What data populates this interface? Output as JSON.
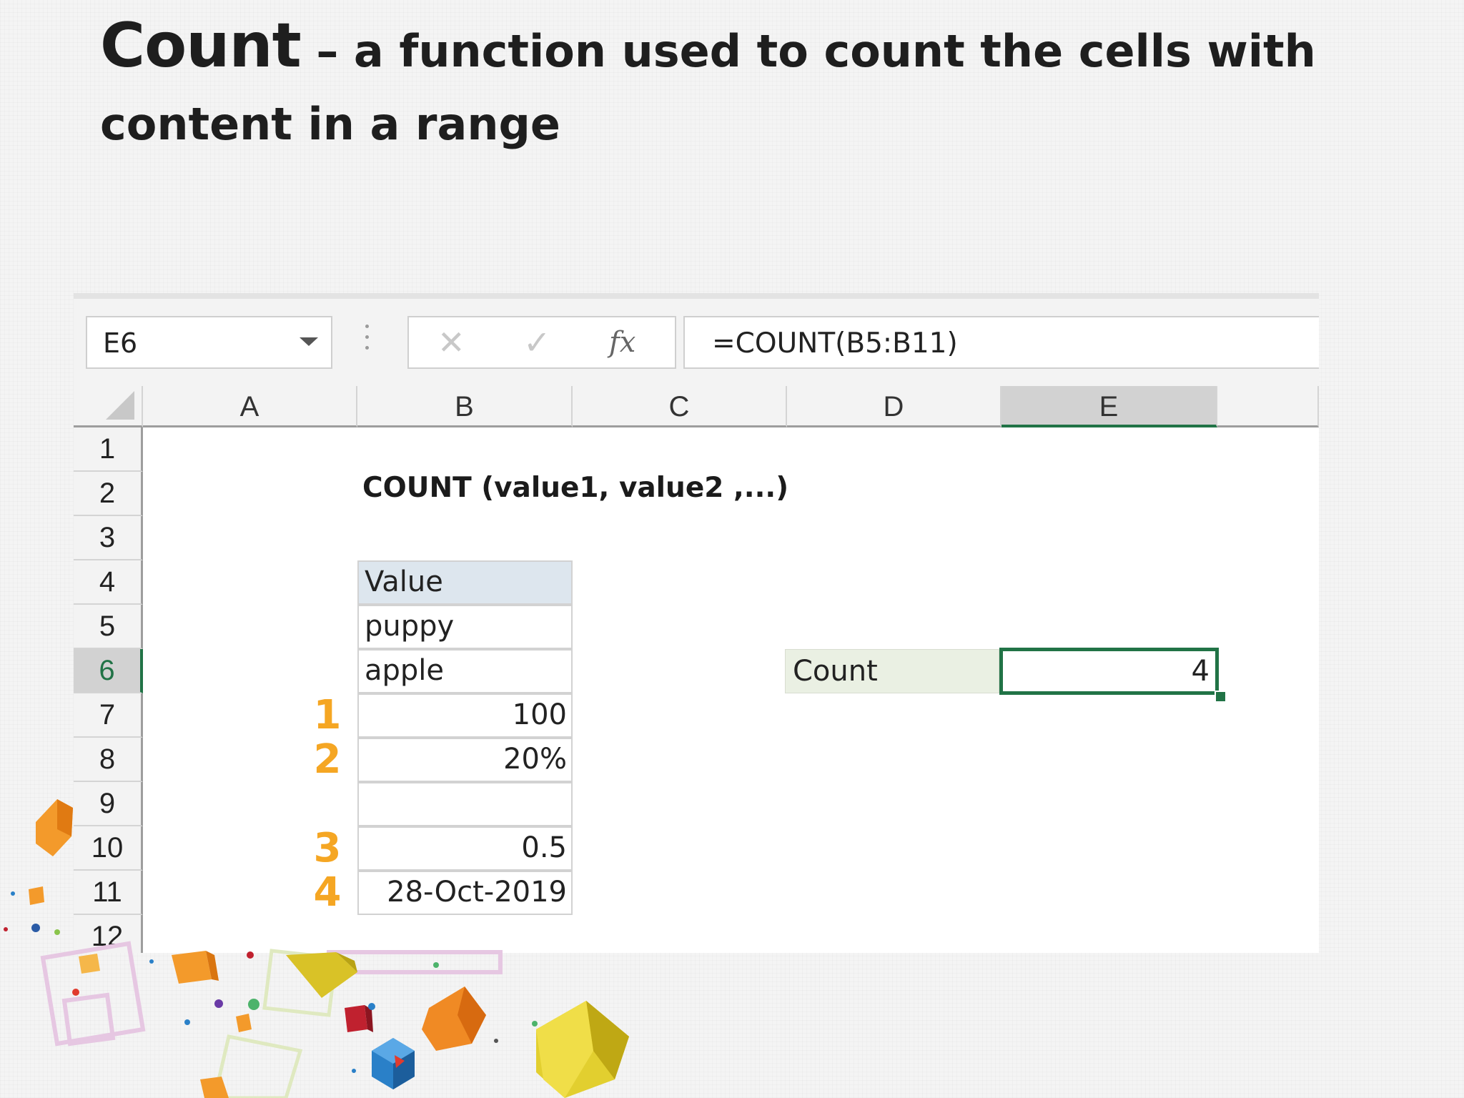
{
  "slide": {
    "title_lead": "Count",
    "title_rest": " – a function used to count the cells with content in a range"
  },
  "excel": {
    "name_box": "E6",
    "formula_icons": [
      "cancel-icon",
      "enter-icon",
      "fx-icon"
    ],
    "fx_label": "fx",
    "cancel_glyph": "✕",
    "enter_glyph": "✓",
    "formula": "=COUNT(B5:B11)",
    "columns": [
      "A",
      "B",
      "C",
      "D",
      "E"
    ],
    "selected_column": "E",
    "rows": [
      "1",
      "2",
      "3",
      "4",
      "5",
      "6",
      "7",
      "8",
      "9",
      "10",
      "11",
      "12"
    ],
    "selected_row": "6",
    "syntax": "COUNT (value1, value2 ,...)",
    "values_header": "Value",
    "values": [
      "puppy",
      "apple",
      "100",
      "20%",
      "",
      "0.5",
      "28-Oct-2019"
    ],
    "annotations": [
      "1",
      "2",
      "3",
      "4"
    ],
    "count_label": "Count",
    "count_result": "4",
    "accent_color": "#217346",
    "annotation_color": "#f5a623"
  }
}
